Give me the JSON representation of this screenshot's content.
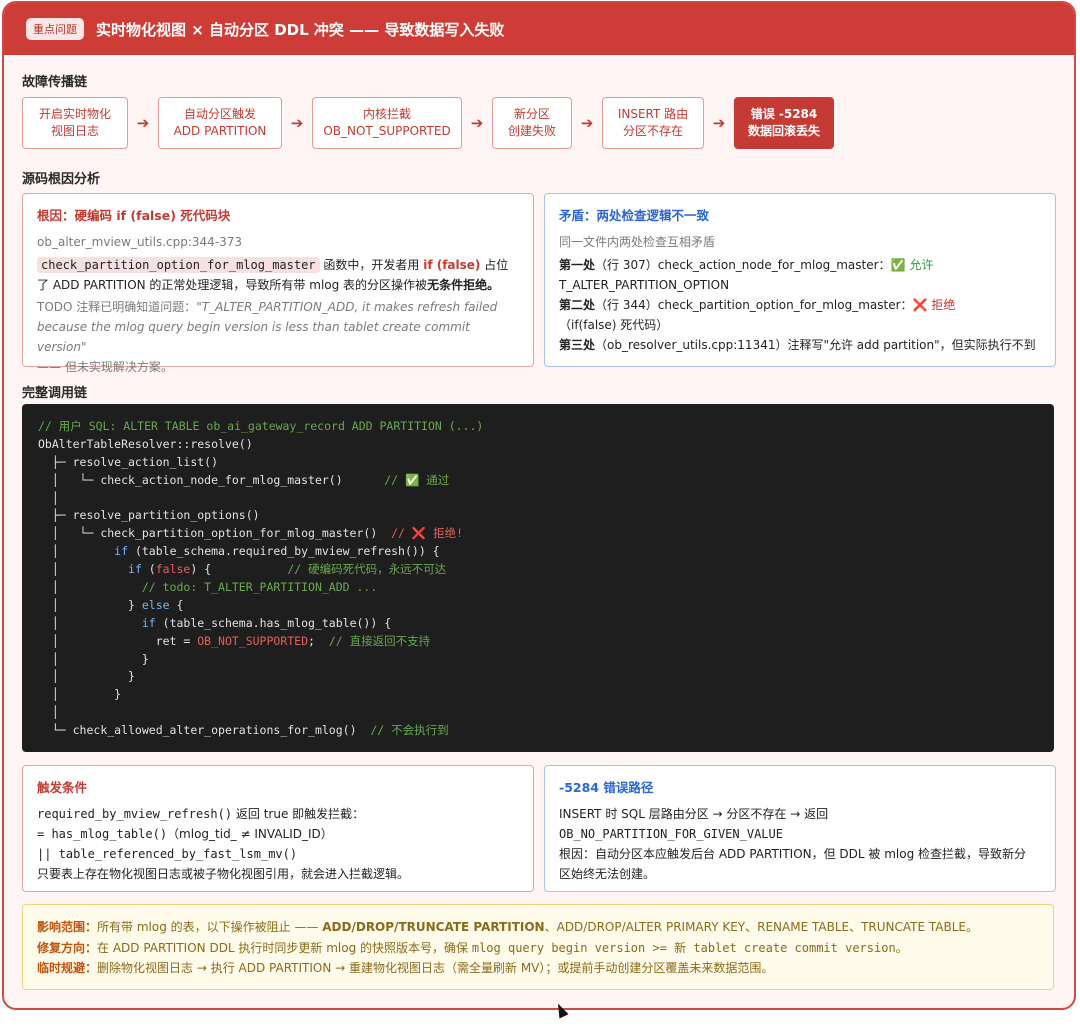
{
  "header": {
    "badge": "重点问题",
    "title": "实时物化视图 × 自动分区 DDL 冲突 —— 导致数据写入失败"
  },
  "chain": {
    "title": "故障传播链",
    "nodes": [
      {
        "l1": "开启实时物化",
        "l2": "视图日志"
      },
      {
        "l1": "自动分区触发",
        "l2": "ADD PARTITION"
      },
      {
        "l1": "内核拦截",
        "l2": "OB_NOT_SUPPORTED"
      },
      {
        "l1": "新分区",
        "l2": "创建失败"
      },
      {
        "l1": "INSERT 路由",
        "l2": "分区不存在"
      },
      {
        "l1": "错误 -5284",
        "l2": "数据回滚丢失"
      }
    ],
    "arrow": "➔"
  },
  "root_section": {
    "title": "源码根因分析"
  },
  "root_cause": {
    "title": "根因：硬编码 if (false) 死代码块",
    "file": "ob_alter_mview_utils.cpp:344-373",
    "func": "check_partition_option_for_mlog_master",
    "t1": "函数中，开发者用",
    "kw": "if (false)",
    "t2": "占位",
    "line2a": "了 ADD PARTITION 的正常处理逻辑，导致所有带 mlog 表的分区操作被",
    "line2b": "无条件拒绝。",
    "todo_a": "TODO 注释已明确知道问题：",
    "todo_b": "\"T_ALTER_PARTITION_ADD, it makes refresh failed",
    "todo_c": "because the mlog query begin version is less than tablet create commit version\"",
    "todo_d": "—— 但未实现解决方案。"
  },
  "conflict": {
    "title": "矛盾：两处检查逻辑不一致",
    "subtitle": "同一文件内两处检查互相矛盾",
    "p1_label": "第一处",
    "p1_text": "（行 307）check_action_node_for_mlog_master：",
    "p1_icon": "✅",
    "p1_result": "允许",
    "p1_cont": "T_ALTER_PARTITION_OPTION",
    "p2_label": "第二处",
    "p2_text": "（行 344）check_partition_option_for_mlog_master：",
    "p2_icon": "❌",
    "p2_result": "拒绝",
    "p2_cont": "（if(false) 死代码）",
    "p3_label": "第三处",
    "p3_text": "（ob_resolver_utils.cpp:11341）注释写\"允许 add partition\"，但实际执行不到"
  },
  "callchain": {
    "title": "完整调用链",
    "l1": "// 用户 SQL: ALTER TABLE ob_ai_gateway_record ADD PARTITION (...)",
    "l2": "ObAlterTableResolver::resolve()",
    "l3": "resolve_action_list()",
    "l4": "check_action_node_for_mlog_master()",
    "l4c": "// ✅ 通过",
    "l6": "resolve_partition_options()",
    "l7": "check_partition_option_for_mlog_master()",
    "l7c": "// ❌ 拒绝!",
    "l8a": "if",
    "l8b": " (table_schema.required_by_mview_refresh()) {",
    "l9a": "if",
    "l9b": " (",
    "l9c": "false",
    "l9d": ") {",
    "l9e": "// 硬编码死代码，永远不可达",
    "l10": "// todo: T_ALTER_PARTITION_ADD ...",
    "l11a": "} ",
    "l11b": "else",
    "l11c": " {",
    "l12a": "if",
    "l12b": " (table_schema.has_mlog_table()) {",
    "l13a": "ret = ",
    "l13b": "OB_NOT_SUPPORTED",
    "l13c": ";",
    "l13d": "// 直接返回不支持",
    "l14": "}",
    "l15": "}",
    "l16": "}",
    "l18": "check_allowed_alter_operations_for_mlog()",
    "l18c": "// 不会执行到"
  },
  "trigger": {
    "title": "触发条件",
    "r1a": "required_by_mview_refresh()",
    "r1b": " 返回 true 即触发拦截：",
    "r2a": "= has_mlog_table()",
    "r2b": "（mlog_tid_ ≠ INVALID_ID）",
    "r3a": "|| table_referenced_by_fast_lsm_mv()",
    "r4": "只要表上存在物化视图日志或被子物化视图引用，就会进入拦截逻辑。"
  },
  "error_path": {
    "title": "-5284 错误路径",
    "r1": "INSERT 时 SQL 层路由分区 → 分区不存在 → 返回",
    "r2": "OB_NO_PARTITION_FOR_GIVEN_VALUE",
    "r3": "根因：自动分区本应触发后台 ADD PARTITION，但 DDL 被 mlog 检查拦截，导致新分",
    "r4": "区始终无法创建。"
  },
  "impact": {
    "l1_label": "影响范围：",
    "l1_a": "所有带 mlog 的表，以下操作被阻止 —— ",
    "l1_b": "ADD/DROP/TRUNCATE PARTITION",
    "l1_c": "、ADD/DROP/ALTER PRIMARY KEY、RENAME TABLE、TRUNCATE TABLE。",
    "l2_label": "修复方向：",
    "l2_a": "在 ADD PARTITION DDL 执行时同步更新 mlog 的快照版本号，确保 ",
    "l2_b": "mlog query begin version >= 新 tablet create commit version",
    "l2_c": "。",
    "l3_label": "临时规避：",
    "l3_a": "删除物化视图日志 → 执行 ADD PARTITION → 重建物化视图日志（需全量刷新 MV）；或提前手动创建分区覆盖未来数据范围。"
  }
}
